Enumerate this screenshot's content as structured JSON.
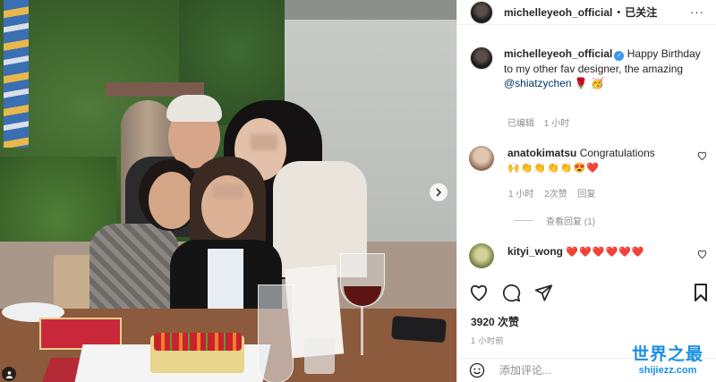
{
  "post": {
    "author": "michelleyeoh_official",
    "follow_status": "已关注",
    "separator": "•",
    "more": "···"
  },
  "caption": {
    "username": "michelleyeoh_official",
    "text_1": "Happy Birthday to my other fav designer, the amazing ",
    "mention": "@shiatzychen",
    "emoji": "🌹 🥳",
    "meta_edited": "已编辑",
    "meta_time": "1 小时"
  },
  "comments": [
    {
      "username": "anatokimatsu",
      "text": "Congratulations",
      "emojis": "🙌👏👏👏👏😍❤️",
      "time": "1 小时",
      "likes": "2次赞",
      "reply": "回复",
      "view_replies": "查看回复 (1)"
    },
    {
      "username": "kityi_wong",
      "emojis": "❤️❤️❤️❤️❤️❤️"
    }
  ],
  "stats": {
    "likes": "3920 次赞",
    "posted": "1 小时前"
  },
  "add_comment": {
    "placeholder": "添加评论..."
  },
  "watermark": {
    "title": "世界之最",
    "url": "shijiezz.com"
  },
  "colors": {
    "mention": "#00376b",
    "heart": "#ed4956",
    "watermark": "#1a8fe3",
    "verified": "#3897f0"
  }
}
